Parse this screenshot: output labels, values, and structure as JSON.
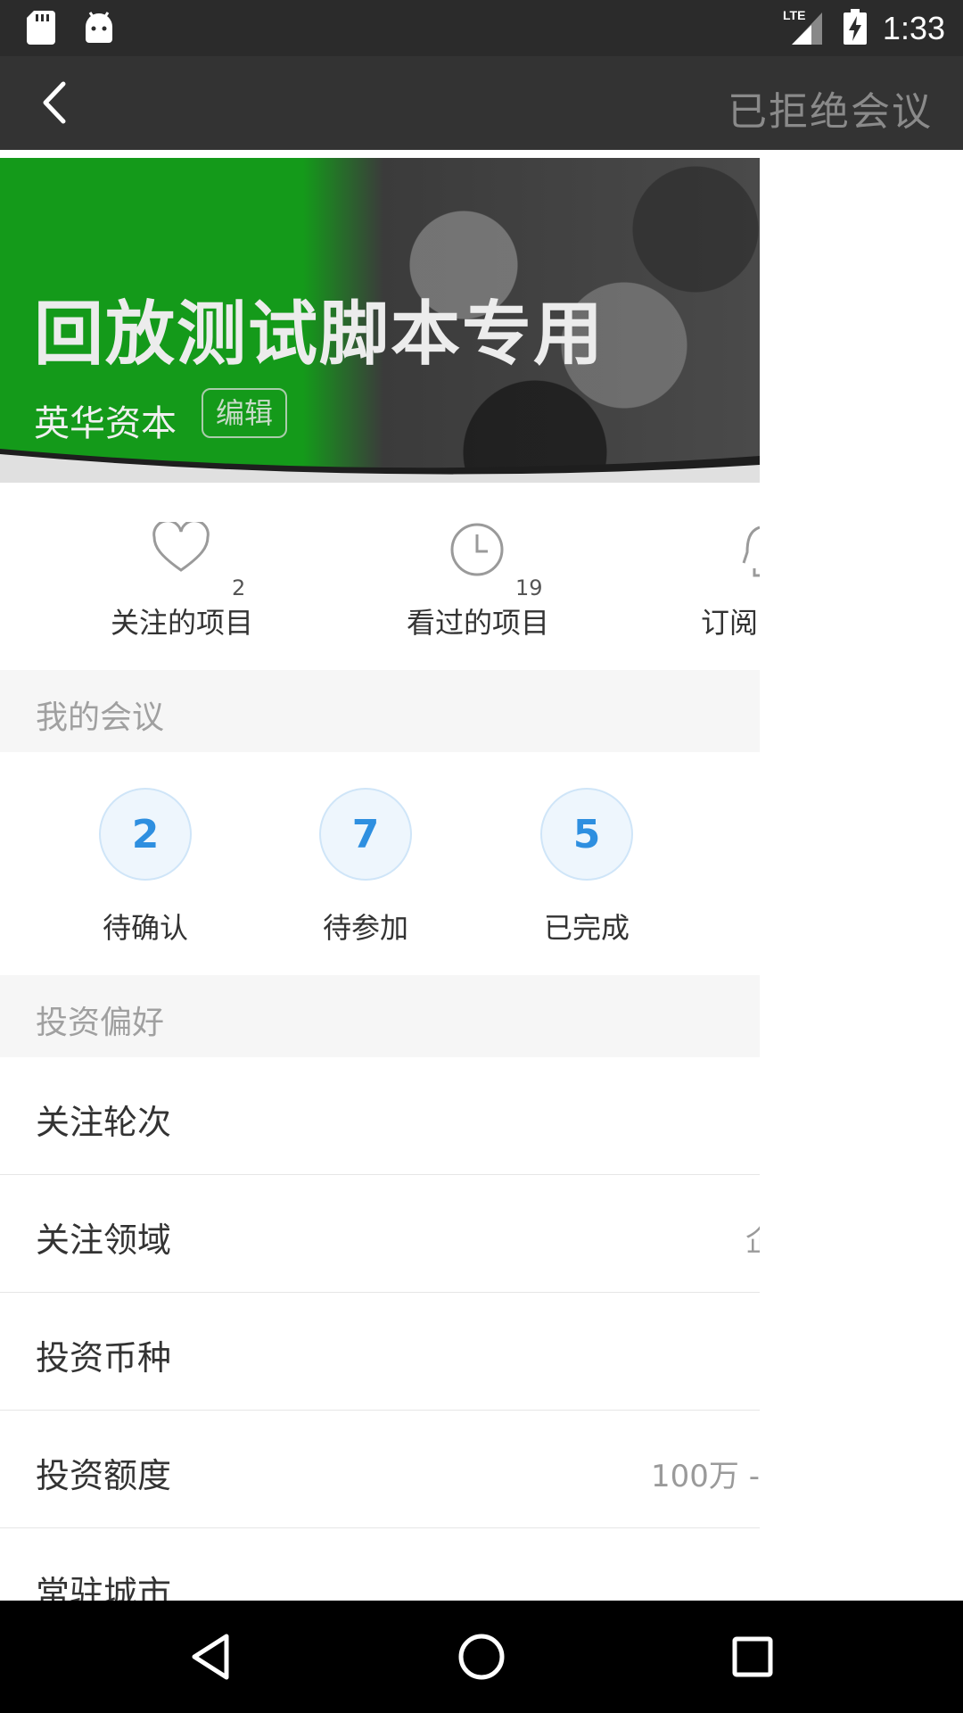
{
  "status_bar": {
    "time": "1:33",
    "network": "LTE",
    "left_icons": [
      "sd-card-icon",
      "android-icon"
    ],
    "right_icons": [
      "lte-signal-icon",
      "battery-charging-icon"
    ]
  },
  "app_bar": {
    "title": "已拒绝会议",
    "back_icon": "chevron-left-icon"
  },
  "banner": {
    "title": "回放测试脚本专用",
    "organization": "英华资本",
    "edit_label": "编辑",
    "accent_color": "#149a1a"
  },
  "stats": [
    {
      "label": "关注的项目",
      "count": "2",
      "icon": "heart-outline-icon"
    },
    {
      "label": "看过的项目",
      "count": "19",
      "icon": "clock-icon"
    },
    {
      "label": "订阅",
      "count": "",
      "icon": "bell-icon"
    }
  ],
  "meetings_section": {
    "title": "我的会议",
    "items": [
      {
        "count": "2",
        "label": "待确认"
      },
      {
        "count": "7",
        "label": "待参加"
      },
      {
        "count": "5",
        "label": "已完成"
      }
    ],
    "circle_color": "#2e8fe0"
  },
  "preferences_section": {
    "title": "投资偏好",
    "rows": [
      {
        "label": "关注轮次",
        "value": ""
      },
      {
        "label": "关注领域",
        "value": "企"
      },
      {
        "label": "投资币种",
        "value": ""
      },
      {
        "label": "投资额度",
        "value": "100万 -"
      },
      {
        "label": "常驻城市",
        "value": ""
      }
    ]
  },
  "nav_bar": {
    "buttons": [
      "back-triangle-icon",
      "home-circle-icon",
      "recents-square-icon"
    ]
  }
}
